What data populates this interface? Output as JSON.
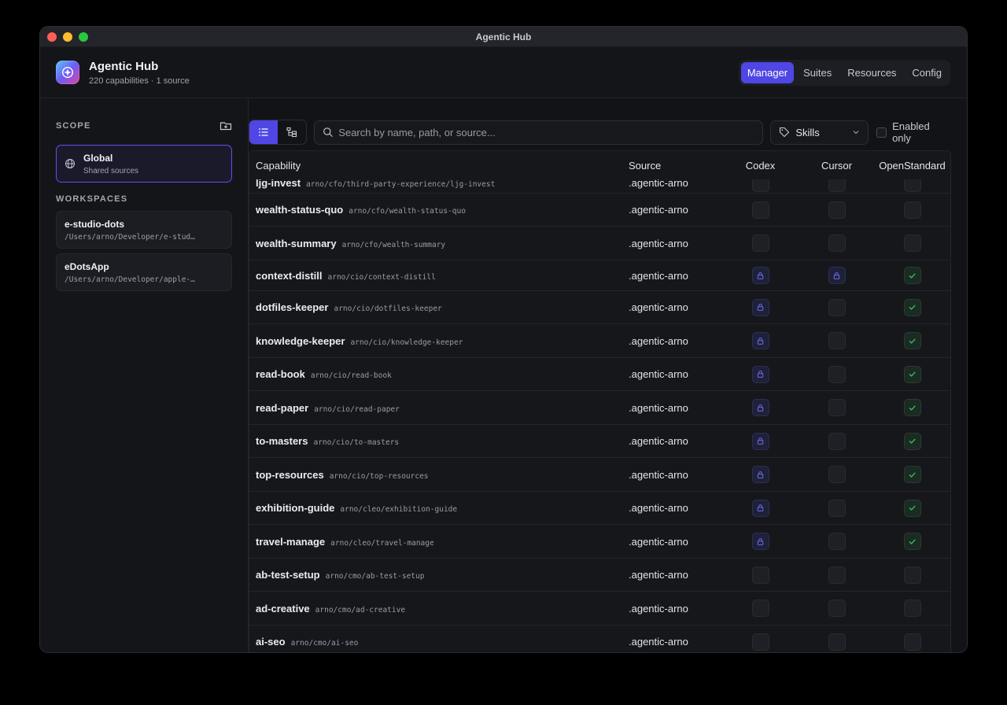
{
  "window": {
    "title": "Agentic Hub"
  },
  "header": {
    "title": "Agentic Hub",
    "subtitle": "220 capabilities · 1 source",
    "tabs": [
      {
        "label": "Manager",
        "active": true
      },
      {
        "label": "Suites",
        "active": false
      },
      {
        "label": "Resources",
        "active": false
      },
      {
        "label": "Config",
        "active": false
      }
    ]
  },
  "sidebar": {
    "scope_label": "SCOPE",
    "scope": {
      "title": "Global",
      "subtitle": "Shared sources"
    },
    "workspaces_label": "WORKSPACES",
    "workspaces": [
      {
        "name": "e-studio-dots",
        "path": "/Users/arno/Developer/e-stud…"
      },
      {
        "name": "eDotsApp",
        "path": "/Users/arno/Developer/apple-…"
      }
    ]
  },
  "toolbar": {
    "search_placeholder": "Search by name, path, or source...",
    "filter_value": "Skills",
    "enabled_only_label": "Enabled only"
  },
  "table": {
    "columns": [
      "Capability",
      "Source",
      "Codex",
      "Cursor",
      "OpenStandard"
    ],
    "rows": [
      {
        "name": "ljg-invest",
        "path": "arno/cfo/third-party-experience/ljg-invest",
        "source": ".agentic-arno",
        "codex": "off",
        "cursor": "off",
        "openstandard": "off"
      },
      {
        "name": "wealth-status-quo",
        "path": "arno/cfo/wealth-status-quo",
        "source": ".agentic-arno",
        "codex": "off",
        "cursor": "off",
        "openstandard": "off"
      },
      {
        "name": "wealth-summary",
        "path": "arno/cfo/wealth-summary",
        "source": ".agentic-arno",
        "codex": "off",
        "cursor": "off",
        "openstandard": "off"
      },
      {
        "name": "context-distill",
        "path": "arno/cio/context-distill",
        "source": ".agentic-arno",
        "codex": "lock",
        "cursor": "lock",
        "openstandard": "check"
      },
      {
        "name": "dotfiles-keeper",
        "path": "arno/cio/dotfiles-keeper",
        "source": ".agentic-arno",
        "codex": "lock",
        "cursor": "off",
        "openstandard": "check"
      },
      {
        "name": "knowledge-keeper",
        "path": "arno/cio/knowledge-keeper",
        "source": ".agentic-arno",
        "codex": "lock",
        "cursor": "off",
        "openstandard": "check"
      },
      {
        "name": "read-book",
        "path": "arno/cio/read-book",
        "source": ".agentic-arno",
        "codex": "lock",
        "cursor": "off",
        "openstandard": "check"
      },
      {
        "name": "read-paper",
        "path": "arno/cio/read-paper",
        "source": ".agentic-arno",
        "codex": "lock",
        "cursor": "off",
        "openstandard": "check"
      },
      {
        "name": "to-masters",
        "path": "arno/cio/to-masters",
        "source": ".agentic-arno",
        "codex": "lock",
        "cursor": "off",
        "openstandard": "check"
      },
      {
        "name": "top-resources",
        "path": "arno/cio/top-resources",
        "source": ".agentic-arno",
        "codex": "lock",
        "cursor": "off",
        "openstandard": "check"
      },
      {
        "name": "exhibition-guide",
        "path": "arno/cleo/exhibition-guide",
        "source": ".agentic-arno",
        "codex": "lock",
        "cursor": "off",
        "openstandard": "check"
      },
      {
        "name": "travel-manage",
        "path": "arno/cleo/travel-manage",
        "source": ".agentic-arno",
        "codex": "lock",
        "cursor": "off",
        "openstandard": "check"
      },
      {
        "name": "ab-test-setup",
        "path": "arno/cmo/ab-test-setup",
        "source": ".agentic-arno",
        "codex": "off",
        "cursor": "off",
        "openstandard": "off"
      },
      {
        "name": "ad-creative",
        "path": "arno/cmo/ad-creative",
        "source": ".agentic-arno",
        "codex": "off",
        "cursor": "off",
        "openstandard": "off"
      },
      {
        "name": "ai-seo",
        "path": "arno/cmo/ai-seo",
        "source": ".agentic-arno",
        "codex": "off",
        "cursor": "off",
        "openstandard": "off"
      }
    ]
  },
  "colors": {
    "accent": "#4f46e5",
    "check": "#34c759",
    "lock": "#6e6af7"
  }
}
